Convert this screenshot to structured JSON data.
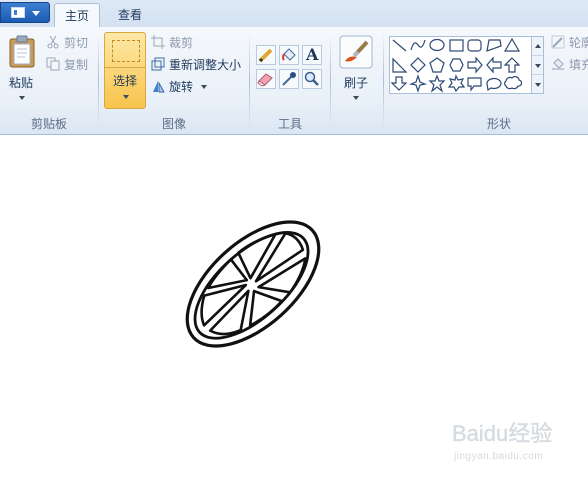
{
  "tabs": {
    "home": "主页",
    "view": "查看"
  },
  "clipboard": {
    "paste": "粘贴",
    "cut": "剪切",
    "copy": "复制",
    "label": "剪贴板"
  },
  "image": {
    "select": "选择",
    "crop": "裁剪",
    "resize": "重新调整大小",
    "rotate": "旋转",
    "label": "图像"
  },
  "tools": {
    "label": "工具",
    "text_tool": "A"
  },
  "brushes": {
    "label": "刷子"
  },
  "shapes": {
    "label": "形状",
    "outline": "轮廓",
    "fill": "填充"
  },
  "watermark": {
    "brand": "Baidu经验",
    "url": "jingyan.baidu.com"
  }
}
